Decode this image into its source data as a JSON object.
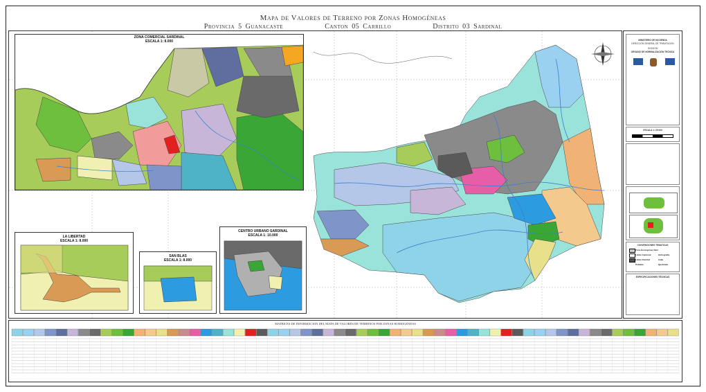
{
  "title": {
    "line1": "Mapa de Valores de Terreno por Zonas Homogéneas",
    "provincia": "Provincia 5 Guanacaste",
    "canton": "Canton 05  Carrillo",
    "distrito": "Distrito 03 Sardinal"
  },
  "insets": {
    "zona_comercial": {
      "name": "ZONA COMERCIAL SARDINAL",
      "scale": "ESCALA 1: 8.000"
    },
    "la_libertad": {
      "name": "LA LIBERTAD",
      "scale": "ESCALA 1: 8.000"
    },
    "san_blas": {
      "name": "SAN BLAS",
      "scale": "ESCALA 1: 8.000"
    },
    "centro_urbano": {
      "name": "CENTRO URBANO SARDINAL",
      "scale": "ESCALA 1: 10.000"
    }
  },
  "legend": {
    "ministry": "MINISTERIO DE HACIENDA",
    "direction": "DIRECCION GENERAL DE TRIBUTACION",
    "division": "DIVISION",
    "organ": "ORGANO DE NORMALIZACION TECNICA",
    "scale": "ESCALA 1: 25 000",
    "conventions": "CONVENCIONES TEMATICAS",
    "conv_items": [
      "Zona Homogénea Valor",
      "Límite Cantonal",
      "Hidrografía",
      "Límite Distrital",
      "Calle",
      "Poblado",
      "Quebrada"
    ],
    "specs": "ESPECIFICACIONES TÉCNICAS",
    "compass": {
      "n": "N",
      "s": "S",
      "e": "E",
      "w": "W"
    }
  },
  "matrix": {
    "title": "MATRICES DE INFORMACION DEL MAPA DE VALORES DE TERRENOS POR ZONAS HOMOGENEAS"
  },
  "colors": {
    "sea": "#ffffff",
    "zone_colors": [
      "#8fd3e8",
      "#9ad0f0",
      "#b5c7e8",
      "#7f95c9",
      "#5f6e9f",
      "#c7b6d8",
      "#8a8a8a",
      "#6a6a6a",
      "#a7cc5a",
      "#6fbf3e",
      "#3aa636",
      "#f1b276",
      "#f4c98e",
      "#e8e08a",
      "#d89a55",
      "#c98c8c",
      "#e65ea5",
      "#2c9be0",
      "#4fb3c7",
      "#99e3da",
      "#f0f0b0",
      "#e22020",
      "#5a5a5a"
    ]
  }
}
